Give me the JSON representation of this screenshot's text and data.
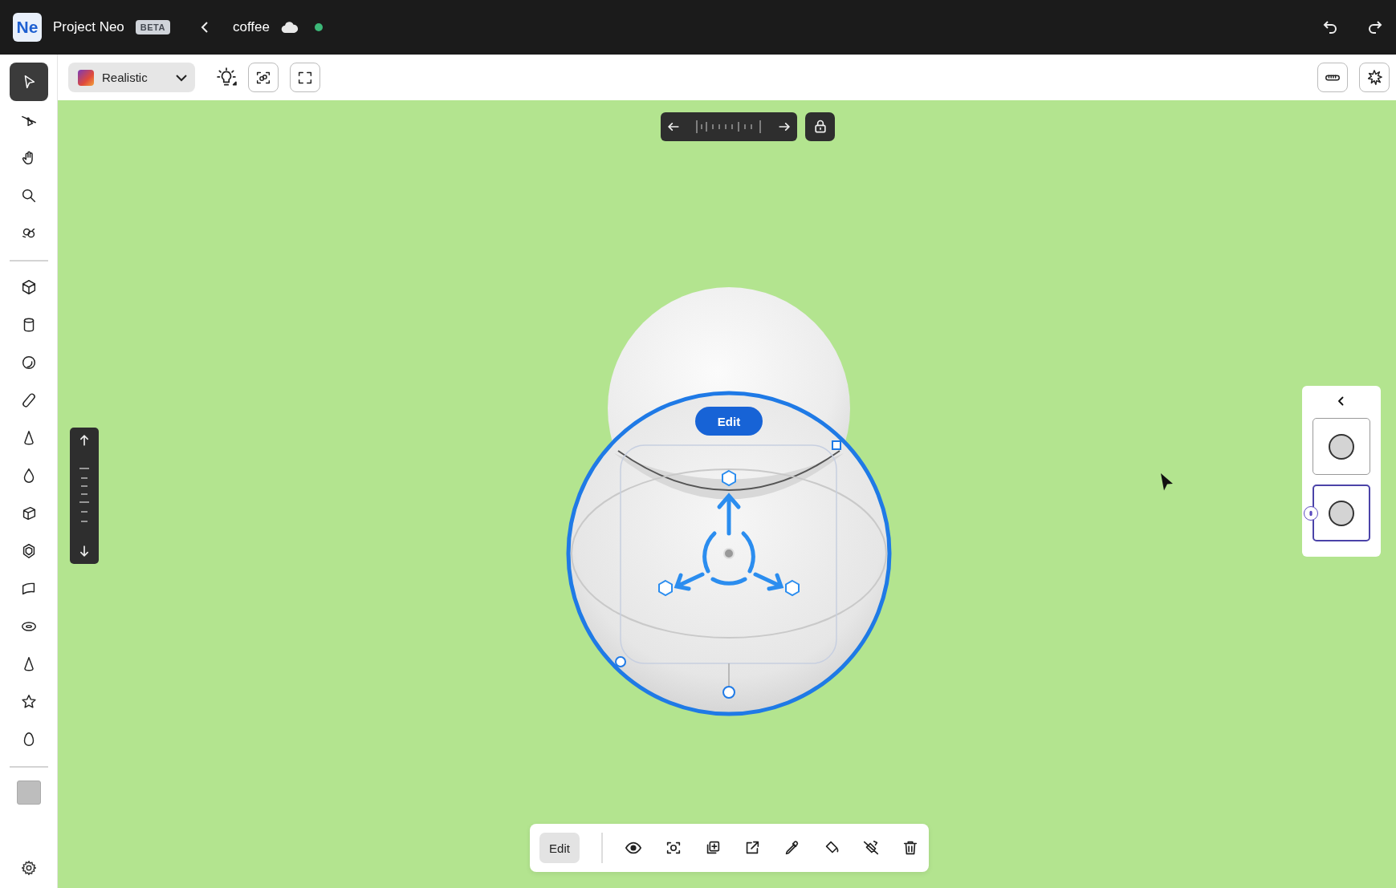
{
  "header": {
    "logo": "Ne",
    "app_name": "Project Neo",
    "badge": "BETA",
    "document": "coffee",
    "saved": true
  },
  "toolbar": {
    "style": {
      "value": "Realistic"
    }
  },
  "tool_groups": [
    [
      {
        "kind": "select",
        "selected": true
      },
      {
        "kind": "pen",
        "selected": false
      },
      {
        "kind": "hand",
        "selected": false
      },
      {
        "kind": "zoom",
        "selected": false
      },
      {
        "kind": "orbit",
        "selected": false
      }
    ],
    [
      {
        "kind": "cube",
        "selected": false
      },
      {
        "kind": "cylinder",
        "selected": false
      },
      {
        "kind": "sphere",
        "selected": false
      },
      {
        "kind": "capsule",
        "selected": false
      },
      {
        "kind": "cone",
        "selected": false
      },
      {
        "kind": "drop",
        "selected": false
      },
      {
        "kind": "box",
        "selected": false
      },
      {
        "kind": "polyhedron",
        "selected": false
      },
      {
        "kind": "curved-plane",
        "selected": false
      },
      {
        "kind": "torus",
        "selected": false
      },
      {
        "kind": "cone",
        "selected": false
      },
      {
        "kind": "star",
        "selected": false
      },
      {
        "kind": "egg",
        "selected": false
      }
    ],
    [
      {
        "kind": "swatch",
        "selected": false
      }
    ]
  ],
  "canvas": {
    "edit_label": "Edit"
  },
  "view_panel": {
    "items": [
      {
        "selected": false,
        "locked": false
      },
      {
        "selected": true,
        "locked": true
      }
    ]
  },
  "action_bar": {
    "edit_label": "Edit",
    "actions": [
      {
        "kind": "visibility"
      },
      {
        "kind": "focus"
      },
      {
        "kind": "duplicate"
      },
      {
        "kind": "export"
      },
      {
        "kind": "eyedropper"
      },
      {
        "kind": "fill"
      },
      {
        "kind": "clear-fill"
      },
      {
        "kind": "delete"
      }
    ]
  }
}
